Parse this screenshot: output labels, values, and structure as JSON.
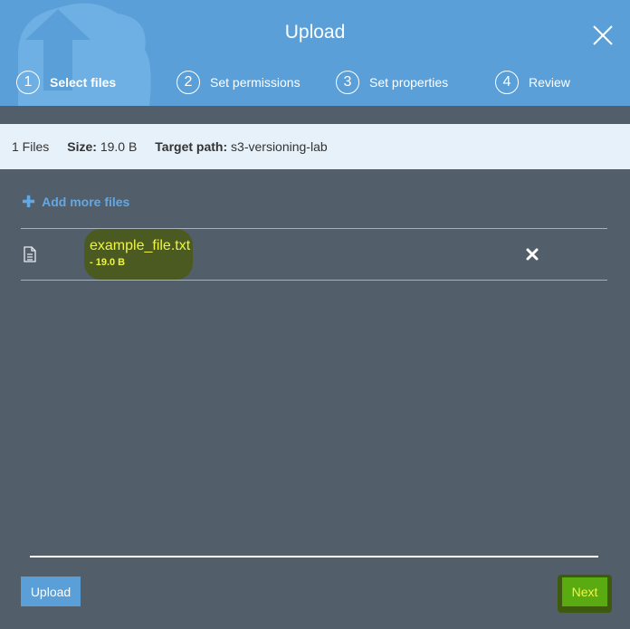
{
  "header": {
    "title": "Upload",
    "close_icon": "close-icon",
    "accent": "#5a9fd8"
  },
  "steps": [
    {
      "num": "1",
      "label": "Select files",
      "active": true
    },
    {
      "num": "2",
      "label": "Set permissions",
      "active": false
    },
    {
      "num": "3",
      "label": "Set properties",
      "active": false
    },
    {
      "num": "4",
      "label": "Review",
      "active": false
    }
  ],
  "info": {
    "count": "1 Files",
    "size_label": "Size:",
    "size_value": "19.0 B",
    "path_label": "Target path:",
    "path_value": "s3-versioning-lab"
  },
  "add_more": {
    "icon": "plus-icon",
    "label": "Add more files"
  },
  "files": [
    {
      "name": "example_file.txt",
      "size": "- 19.0 B"
    }
  ],
  "footer": {
    "upload_label": "Upload",
    "next_label": "Next"
  }
}
